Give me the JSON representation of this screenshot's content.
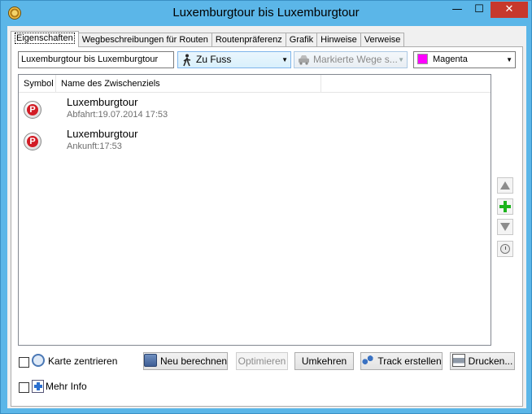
{
  "window": {
    "title": "Luxemburgtour bis Luxemburgtour",
    "min_glyph": "—",
    "max_glyph": "☐",
    "close_glyph": "✕"
  },
  "tabs": [
    {
      "label": "Eigenschaften",
      "active": true
    },
    {
      "label": "Wegbeschreibungen für Routen",
      "active": false
    },
    {
      "label": "Routenpräferenz",
      "active": false
    },
    {
      "label": "Grafik",
      "active": false
    },
    {
      "label": "Hinweise",
      "active": false
    },
    {
      "label": "Verweise",
      "active": false
    }
  ],
  "toolbar": {
    "route_name": "Luxemburgtour bis Luxemburgtour",
    "mode": "Zu Fuss",
    "ways": "Markierte Wege s...",
    "color_name": "Magenta",
    "color_hex": "#ff00ff"
  },
  "list": {
    "col_symbol": "Symbol",
    "col_name": "Name des Zwischenziels",
    "rows": [
      {
        "icon": "parking-icon",
        "symbol": "P",
        "name": "Luxemburgtour",
        "detail": "Abfahrt:19.07.2014 17:53"
      },
      {
        "icon": "parking-icon",
        "symbol": "P",
        "name": "Luxemburgtour",
        "detail": "Ankunft:17:53"
      }
    ]
  },
  "side_buttons": [
    "move-up-icon",
    "add-icon",
    "move-down-icon",
    "clock-icon"
  ],
  "footer": {
    "center_map": "Karte zentrieren",
    "more_info": "Mehr Info",
    "recalc": "Neu berechnen",
    "optimize": "Optimieren",
    "reverse": "Umkehren",
    "create_track": "Track erstellen",
    "print": "Drucken..."
  }
}
